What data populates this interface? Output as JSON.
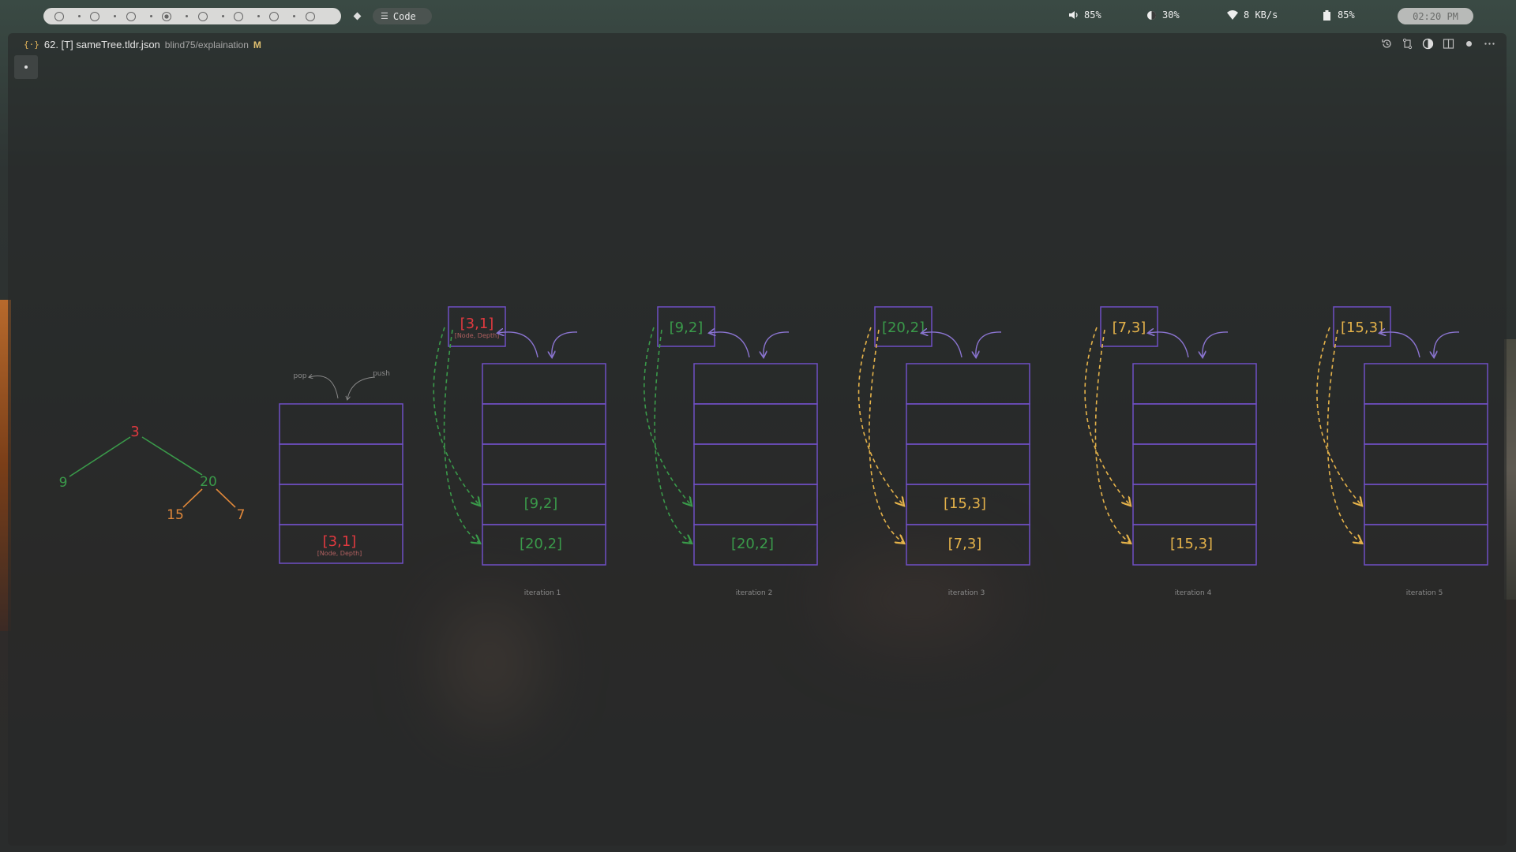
{
  "topbar": {
    "code_label": "Code",
    "volume": "85%",
    "brightness": "30%",
    "network": "8 KB/s",
    "battery": "85%",
    "clock": "02:20 PM"
  },
  "window": {
    "tab_title": "62. [T] sameTree.tldr.json",
    "path": "blind75/explaination",
    "modified_flag": "M"
  },
  "tree": {
    "root": "3",
    "left": "9",
    "right": "20",
    "right_left": "15",
    "right_right": "7"
  },
  "stack_labels": {
    "pop": "pop",
    "push": "push",
    "node_depth": "[Node, Depth]"
  },
  "initial_stack": {
    "bottom": "[3,1]"
  },
  "iterations": [
    {
      "label": "iteration 1",
      "popped": "[3,1]",
      "popped_sub": "[Node, Depth]",
      "slot4": "[9,2]",
      "slot5": "[20,2]"
    },
    {
      "label": "iteration 2",
      "popped": "[9,2]",
      "slot4": "",
      "slot5": "[20,2]"
    },
    {
      "label": "iteration 3",
      "popped": "[20,2]",
      "slot4": "[15,3]",
      "slot5": "[7,3]"
    },
    {
      "label": "iteration 4",
      "popped": "[7,3]",
      "slot4": "",
      "slot5": "[15,3]"
    },
    {
      "label": "iteration 5",
      "popped": "[15,3]",
      "slot4": "",
      "slot5": ""
    }
  ],
  "colors": {
    "stack_border": "#6f4fc4",
    "red": "#e0393f",
    "green": "#3a9a4a",
    "orange": "#e0883a",
    "yellow": "#e4b24a",
    "label_gray": "#8a8a8a"
  }
}
